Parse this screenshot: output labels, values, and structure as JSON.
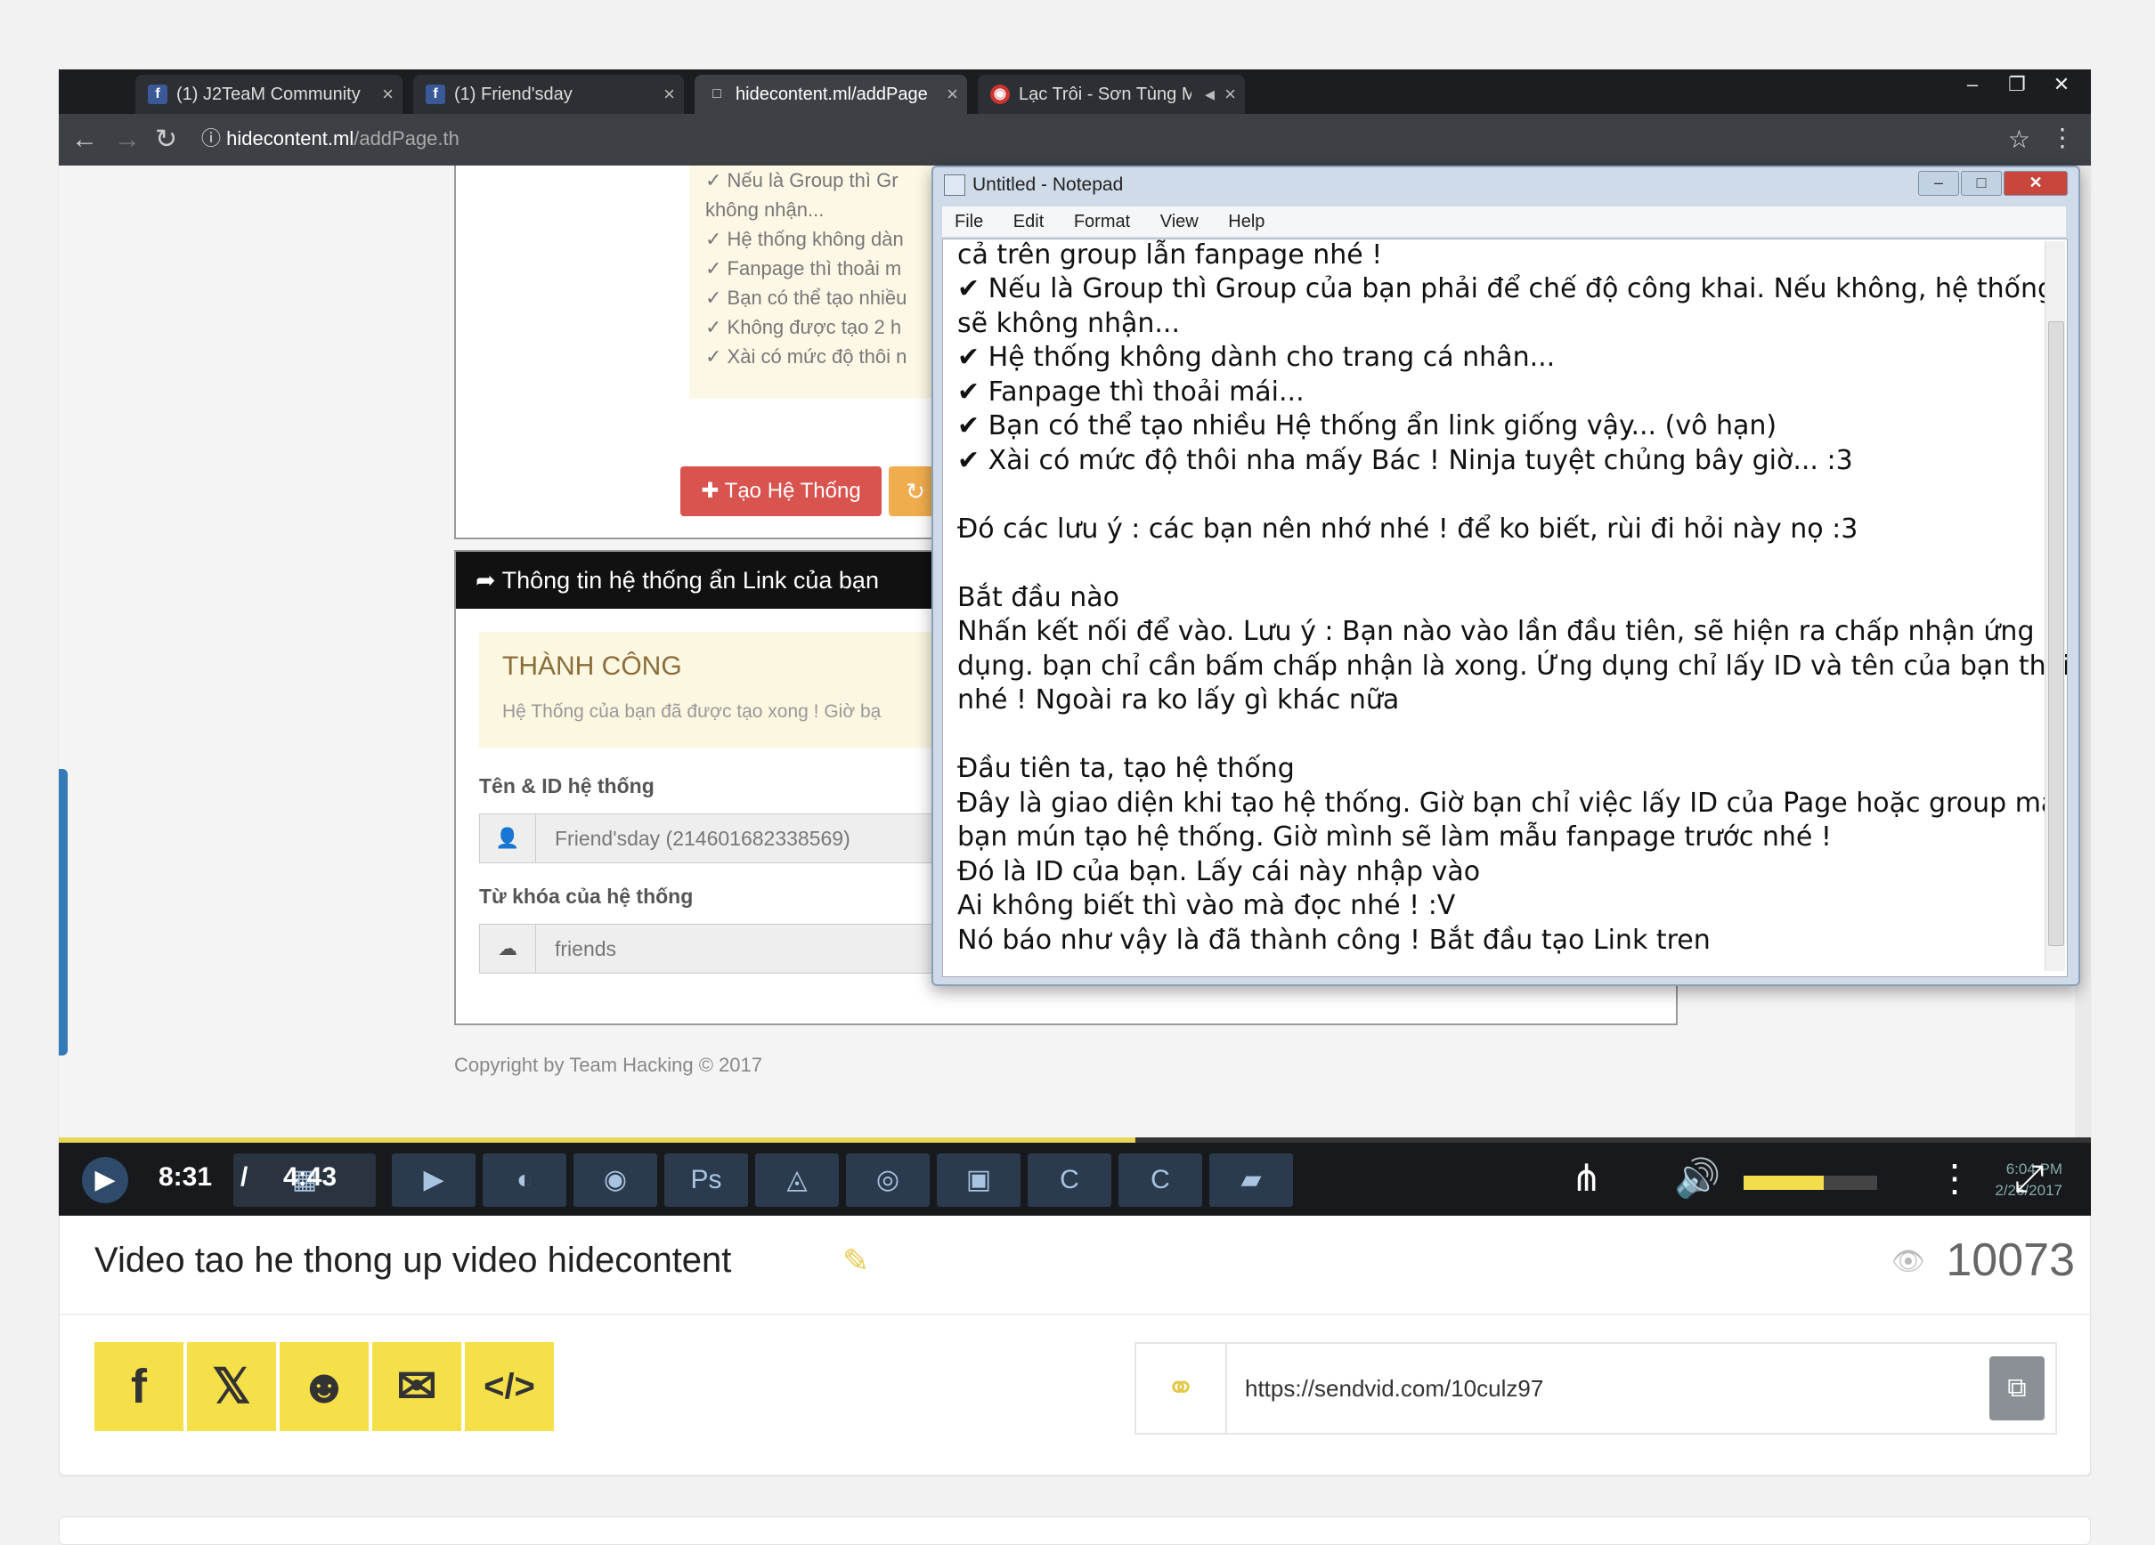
{
  "browser": {
    "tabs": [
      {
        "icon": "f",
        "label": "(1) J2TeaM Community"
      },
      {
        "icon": "f",
        "label": "(1) Friend'sday"
      },
      {
        "icon": "□",
        "label": "hidecontent.ml/addPage"
      },
      {
        "icon": "◉",
        "label": "Lạc Trôi - Sơn Tùng M"
      }
    ],
    "url_host": "hidecontent.ml",
    "url_path": "/addPage.th"
  },
  "page": {
    "notes": [
      "✓ Nếu là Group thì Gr",
      "không nhận...",
      "✓ Hệ thống không dàn",
      "✓ Fanpage thì thoải m",
      "✓ Bạn có thể tạo nhiều",
      "✓ Không được tạo 2 h",
      "✓ Xài có mức độ thôi n"
    ],
    "create_button": "Tạo Hệ Thống",
    "info_header": "Thông tin hệ thống ẩn Link của bạn",
    "success_title": "THÀNH CÔNG",
    "success_text": "Hệ Thống của bạn đã được tạo xong ! Giờ bạ",
    "name_label": "Tên & ID hệ thống",
    "name_value": "Friend'sday (214601682338569)",
    "keyword_label": "Từ khóa của hệ thống",
    "keyword_value": "friends",
    "copyright": "Copyright by Team Hacking © 2017"
  },
  "notepad": {
    "title": "Untitled - Notepad",
    "menu": [
      "File",
      "Edit",
      "Format",
      "View",
      "Help"
    ],
    "lines": [
      "cả trên group lẫn fanpage nhé !",
      "✔ Nếu là Group thì Group của bạn phải để chế độ công khai. Nếu không, hệ thống",
      "sẽ không nhận...",
      "✔ Hệ thống không dành cho trang cá nhân...",
      "✔ Fanpage thì thoải mái...",
      "✔ Bạn có thể tạo nhiều Hệ thống ẩn link giống vậy... (vô hạn)",
      "✔ Xài có mức độ thôi nha mấy Bác ! Ninja tuyệt chủng bây giờ... :3",
      "",
      "Đó các lưu ý : các bạn nên nhớ nhé ! để ko biết, rùi đi hỏi này nọ :3",
      "",
      "Bắt đầu nào",
      "Nhấn kết nối để vào. Lưu ý : Bạn nào vào lần đầu tiên, sẽ hiện ra chấp nhận ứng",
      "dụng. bạn chỉ cần bấm chấp nhận là xong. Ứng dụng chỉ lấy ID và tên của bạn thôi",
      "nhé ! Ngoài ra ko lấy gì khác nữa",
      "",
      "Đầu tiên ta, tạo hệ thống",
      "Đây là giao diện khi tạo hệ thống. Giờ bạn chỉ việc lấy ID của Page hoặc group mà",
      "bạn mún tạo hệ thống. Giờ mình sẽ làm mẫu fanpage trước nhé !",
      "Đó là ID của bạn. Lấy cái này nhập vào",
      "Ai không biết thì vào mà đọc nhé ! :V",
      "Nó báo như vậy là đã thành công ! Bắt đầu tạo Link tren"
    ]
  },
  "player": {
    "current_time": "8:31",
    "separator": "/",
    "duration": "4:43",
    "progress_fraction": 0.53,
    "volume_fraction": 0.6,
    "clock_time": "6:04 PM",
    "clock_date": "2/26/2017",
    "taskbar_icons": [
      "explorer-icon",
      "media-icon",
      "firefox-icon",
      "chrome-icon",
      "photoshop-icon",
      "app-icon",
      "app-icon",
      "monitor-icon",
      "camtasia-icon",
      "camtasia-icon",
      "folder-icon"
    ]
  },
  "video": {
    "title": "Video tao he thong up video hidecontent",
    "views": "10073",
    "share_buttons": [
      "f",
      "𝕏",
      "☻",
      "✉",
      "</>"
    ],
    "share_link": "https://sendvid.com/10culz97",
    "accent_color": "#f6e04a"
  }
}
